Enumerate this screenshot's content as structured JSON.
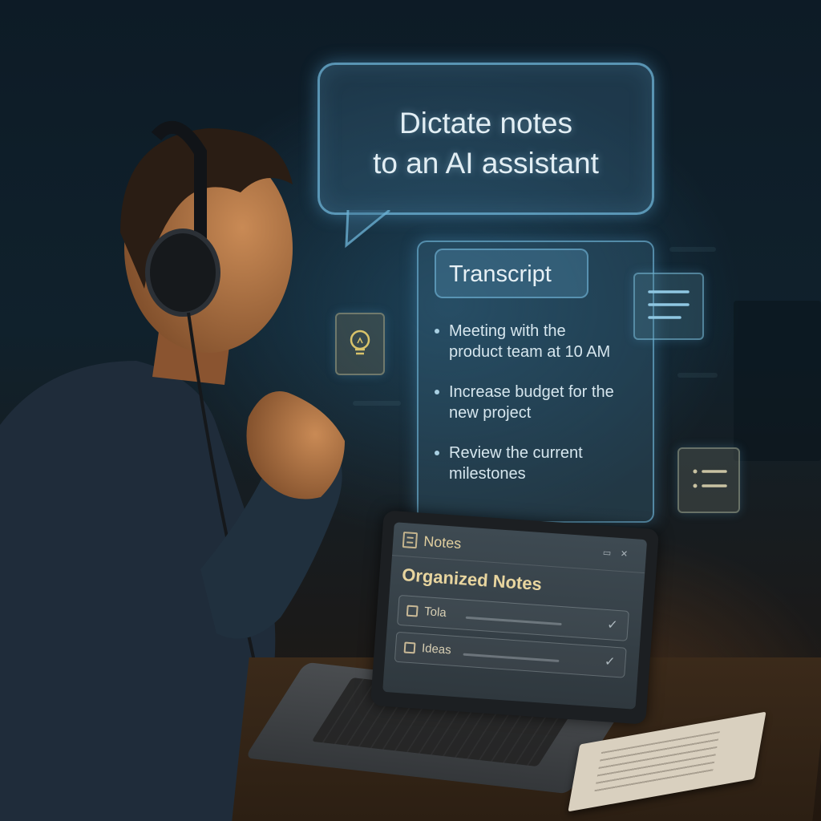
{
  "bubble": {
    "line1": "Dictate notes",
    "line2": "to an AI assistant"
  },
  "transcript": {
    "title": "Transcript",
    "items": [
      {
        "line1": "Meeting with the",
        "line2": "product team at 10 AM"
      },
      {
        "line1": "Increase budget for the",
        "line2": "new project"
      },
      {
        "line1": "Review the current",
        "line2": "milestones"
      }
    ]
  },
  "side_icons": [
    "lightbulb-icon",
    "menu-lines-icon",
    "checklist-icon"
  ],
  "laptop": {
    "app_title": "Notes",
    "heading": "Organized Notes",
    "rows": [
      {
        "label": "Tola",
        "icon": "folder-icon"
      },
      {
        "label": "Ideas",
        "icon": "note-icon"
      }
    ]
  },
  "colors": {
    "glow": "#6eb4d7",
    "accent_text": "#e8d59f",
    "background": "#0d1b26"
  }
}
